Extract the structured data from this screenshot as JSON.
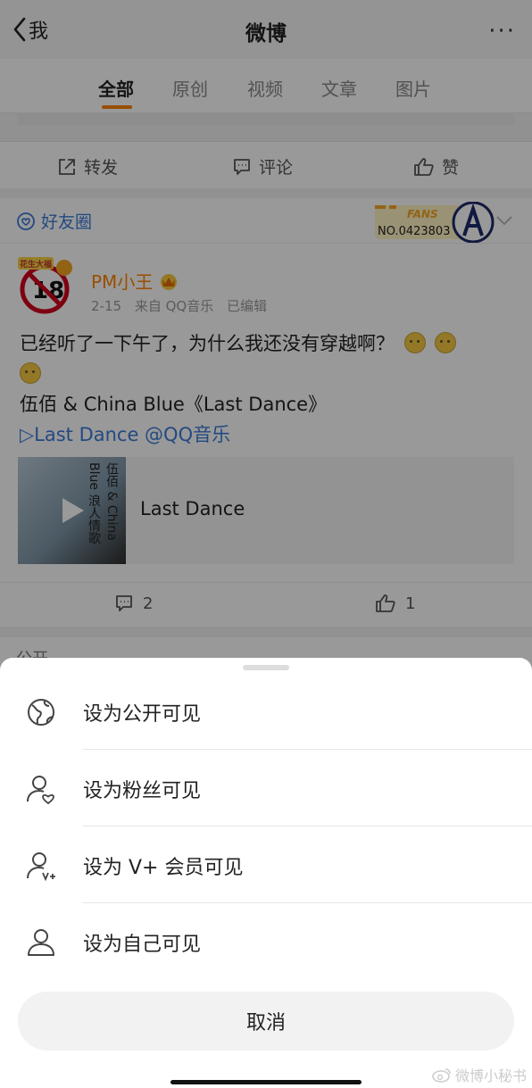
{
  "header": {
    "back_label": "我",
    "title": "微博",
    "more_label": "···"
  },
  "tabs": [
    {
      "label": "全部",
      "active": true
    },
    {
      "label": "原创"
    },
    {
      "label": "视频"
    },
    {
      "label": "文章"
    },
    {
      "label": "图片"
    }
  ],
  "actions": {
    "repost": "转发",
    "comment": "评论",
    "like": "赞"
  },
  "post": {
    "visibility": "好友圈",
    "badge_title": "FANS",
    "badge_number": "NO.0423803",
    "avatar_text": "18",
    "avatar_topline": "花生大福",
    "username": "PM小王",
    "date": "2-15",
    "source": "来自 QQ音乐",
    "edited": "已编辑",
    "text_line1": "已经听了一下午了，为什么我还没有穿越啊？",
    "text_line2": "伍佰 & China Blue《Last Dance》",
    "link_text": "▷Last Dance @QQ音乐",
    "music": {
      "cover_text": "伍佰 & China Blue 浪人情歌",
      "title": "Last Dance"
    },
    "comments_count": "2",
    "likes_count": "1"
  },
  "post2": {
    "visibility": "公开"
  },
  "sheet": {
    "options": [
      {
        "label": "设为公开可见",
        "icon": "globe-icon"
      },
      {
        "label": "设为粉丝可见",
        "icon": "user-heart-icon"
      },
      {
        "label": "设为 V+ 会员可见",
        "icon": "user-vplus-icon"
      },
      {
        "label": "设为自己可见",
        "icon": "user-icon"
      }
    ],
    "cancel": "取消"
  },
  "watermark": "微博小秘书",
  "colors": {
    "accent": "#ff8200",
    "link": "#3b7bd8"
  }
}
